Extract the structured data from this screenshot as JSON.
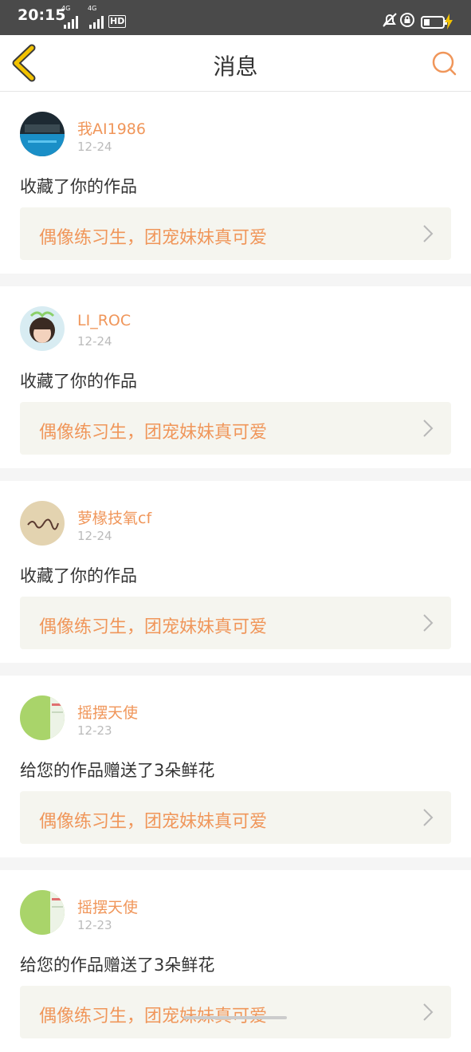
{
  "status_bar": {
    "time": "20:15",
    "net1": "4G",
    "net2": "4G",
    "hd": "HD"
  },
  "header": {
    "title": "消息"
  },
  "colors": {
    "accent": "#f0965a",
    "back_icon": "#f2c200",
    "card_bg": "#f5f5ef"
  },
  "icons": [
    "back-chevron-icon",
    "search-icon",
    "chevron-right-icon",
    "mute-icon",
    "rotation-lock-icon",
    "battery-icon"
  ],
  "messages": [
    {
      "username": "我AI1986",
      "date": "12-24",
      "action": "收藏了你的作品",
      "work_title": "偶像练习生，团宠妹妹真可爱",
      "avatar": "avatar-photo-blue"
    },
    {
      "username": "LI_ROC",
      "date": "12-24",
      "action": "收藏了你的作品",
      "work_title": "偶像练习生，团宠妹妹真可爱",
      "avatar": "avatar-photo-girl"
    },
    {
      "username": "萝椽技氧cf",
      "date": "12-24",
      "action": "收藏了你的作品",
      "work_title": "偶像练习生，团宠妹妹真可爱",
      "avatar": "avatar-calligraphy"
    },
    {
      "username": "摇摆天使",
      "date": "12-23",
      "action": "给您的作品赠送了3朵鲜花",
      "work_title": "偶像练习生，团宠妹妹真可爱",
      "avatar": "avatar-green"
    },
    {
      "username": "摇摆天使",
      "date": "12-23",
      "action": "给您的作品赠送了3朵鲜花",
      "work_title": "偶像练习生，团宠妹妹真可爱",
      "avatar": "avatar-green"
    }
  ]
}
